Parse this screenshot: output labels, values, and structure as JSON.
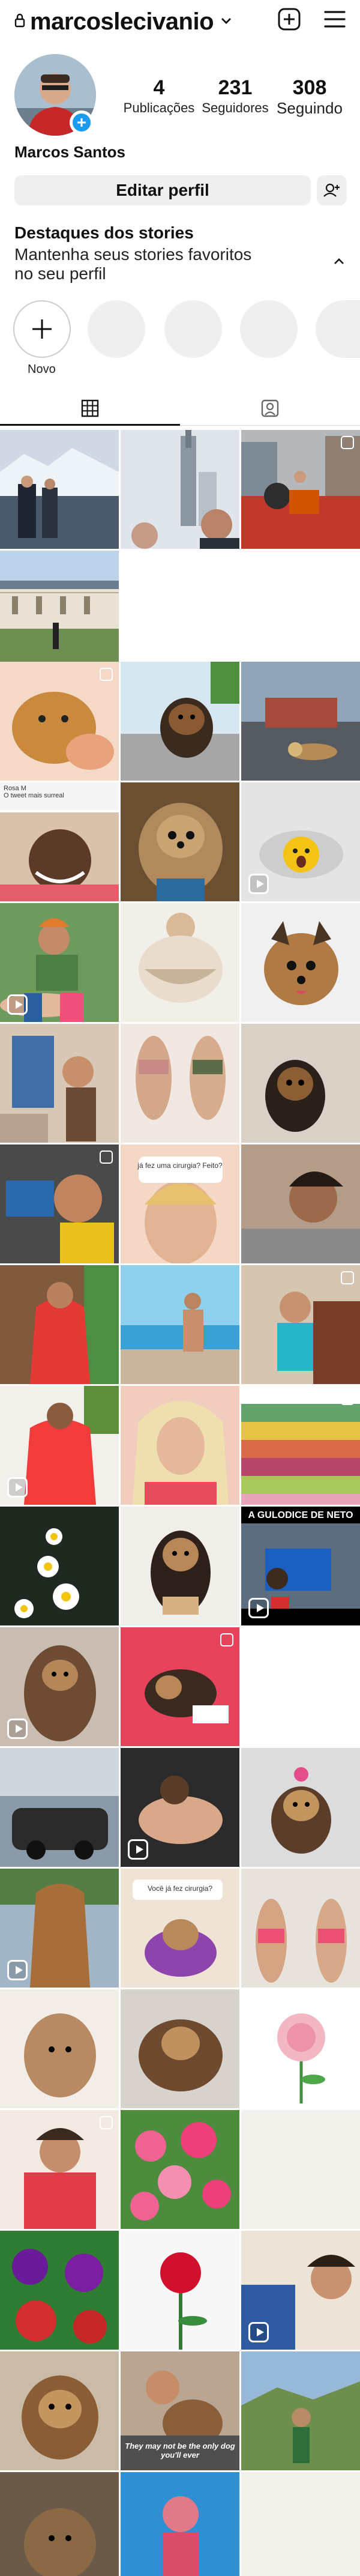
{
  "header": {
    "username": "marcoslecivanio",
    "icons": [
      "lock-icon",
      "chevron-down-icon",
      "create-post-icon",
      "menu-icon"
    ]
  },
  "profile": {
    "display_name": "Marcos Santos",
    "stats": [
      {
        "value": "4",
        "label": "Publicações"
      },
      {
        "value": "231",
        "label": "Seguidores"
      },
      {
        "value": "308",
        "label": "Seguindo"
      }
    ]
  },
  "actions": {
    "edit_profile": "Editar perfil"
  },
  "highlights": {
    "title": "Destaques dos stories",
    "subtitle": "Mantenha seus stories favoritos no seu perfil",
    "new_label": "Novo"
  },
  "tabs": [
    "grid-icon",
    "tagged-icon"
  ],
  "grid": {
    "captions": {
      "tweet": "Rosa M\nO tweet mais surreal",
      "question1": "já fez uma cirurgia? Feito?",
      "neto": "A GULODICE DE NETO",
      "question2": "Você já fez cirurgia?",
      "only_dog": "They may not be the only dog you'll ever"
    },
    "colors": {
      "accent": "#1d9bf0",
      "button_bg": "#efefef"
    }
  }
}
